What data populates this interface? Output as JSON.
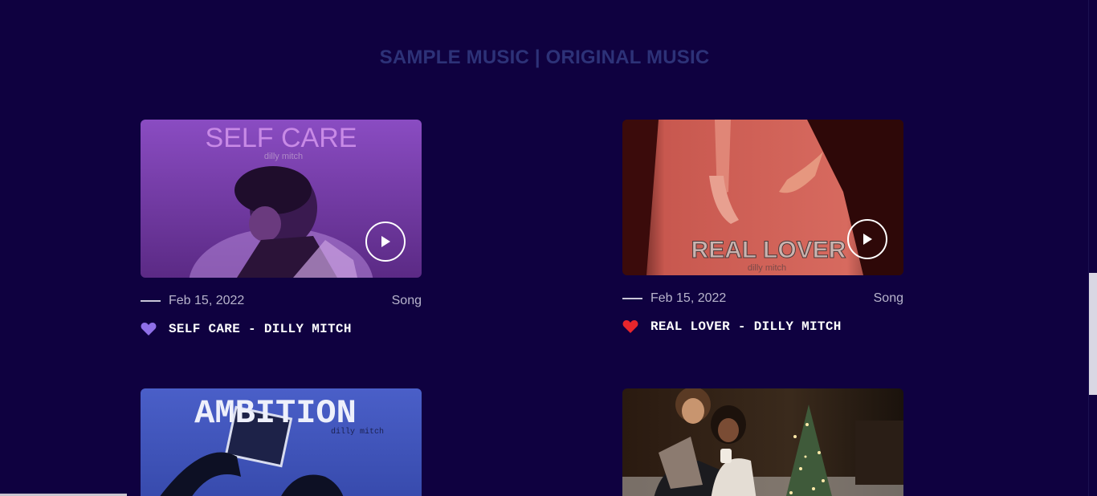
{
  "section": {
    "title": "SAMPLE MUSIC | ORIGINAL MUSIC"
  },
  "cards": [
    {
      "art_title": "SELF CARE",
      "art_artist": "dilly mitch",
      "date": "Feb 15, 2022",
      "category": "Song",
      "heart_icon": "purple-heart-icon",
      "heart_color": "#8f6fe8",
      "title": "SELF CARE - DILLY MITCH"
    },
    {
      "art_title": "REAL LOVER",
      "art_artist": "dilly mitch",
      "date": "Feb 15, 2022",
      "category": "Song",
      "heart_icon": "red-heart-icon",
      "heart_color": "#e8262c",
      "title": "REAL LOVER - DILLY MITCH"
    },
    {
      "art_title": "AMBITION",
      "art_artist": "dilly mitch"
    },
    {}
  ],
  "colors": {
    "background": "#0f0140",
    "section_title": "#2d3278"
  }
}
